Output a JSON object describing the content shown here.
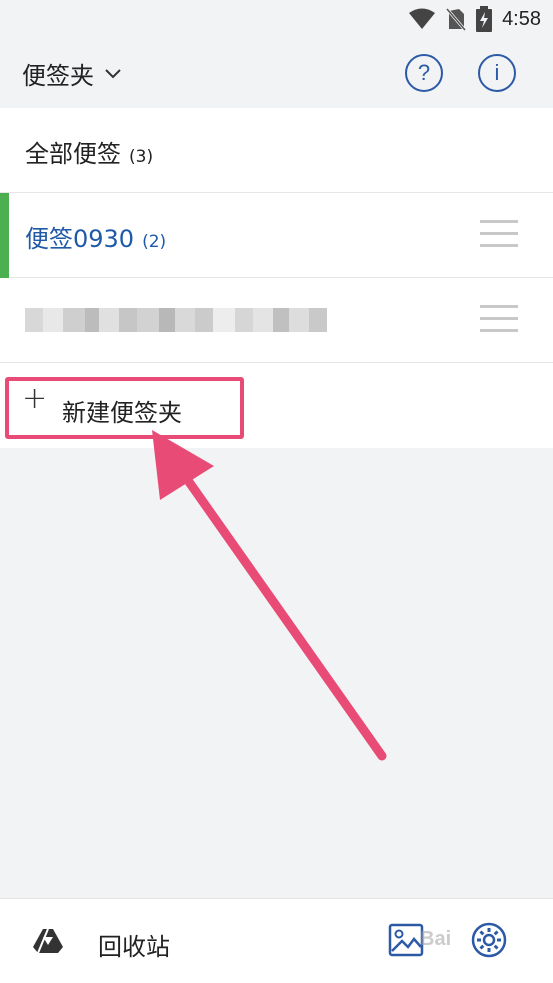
{
  "status_bar": {
    "time": "4:58",
    "icons": [
      "wifi-icon",
      "no-sim-icon",
      "battery-charging-icon"
    ]
  },
  "header": {
    "folder_title": "便签夹",
    "dropdown_icon": "chevron-down-icon",
    "help_icon": "help-icon",
    "info_icon": "info-icon",
    "help_glyph": "?",
    "info_glyph": "i"
  },
  "folders": {
    "items": [
      {
        "label": "全部便签",
        "count": "(3)",
        "active": false,
        "draggable": false
      },
      {
        "label": "便签0930",
        "count": "(2)",
        "active": true,
        "draggable": true
      },
      {
        "label": "",
        "count": "",
        "active": false,
        "draggable": true,
        "blurred": true
      }
    ],
    "new_folder_label": "新建便签夹",
    "new_folder_icon": "plus-icon"
  },
  "bottom_bar": {
    "trash_label": "回收站",
    "trash_icon": "trash-drive-icon",
    "image_icon": "image-icon",
    "settings_icon": "settings-icon"
  },
  "annotation": {
    "highlight_color": "#e84c76"
  },
  "colors": {
    "accent": "#2c5aa6",
    "active_text": "#1f5aa8",
    "active_indicator": "#4caf50",
    "background": "#f2f3f5"
  },
  "watermark": "Bai"
}
